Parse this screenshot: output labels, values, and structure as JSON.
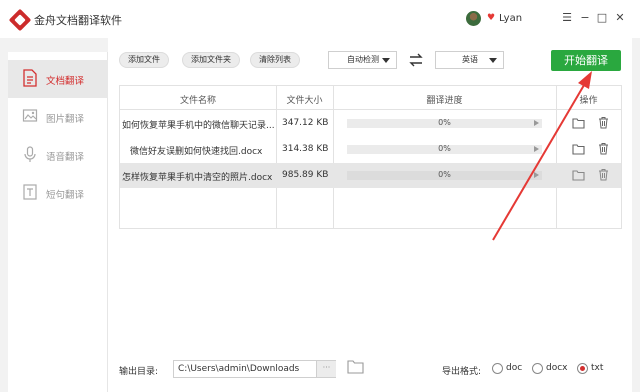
{
  "app": {
    "title": "金舟文档翻译软件",
    "user_name": "Lyan"
  },
  "window_controls": {
    "settings": "☰",
    "minimize": "−",
    "maximize": "□",
    "close": "✕"
  },
  "sidebar": {
    "items": [
      {
        "label": "文档翻译",
        "icon": "document-icon",
        "active": true
      },
      {
        "label": "图片翻译",
        "icon": "image-icon",
        "active": false
      },
      {
        "label": "语音翻译",
        "icon": "microphone-icon",
        "active": false
      },
      {
        "label": "短句翻译",
        "icon": "text-icon",
        "active": false
      }
    ]
  },
  "toolbar": {
    "add_file": "添加文件",
    "add_folder": "添加文件夹",
    "clear_list": "清除列表",
    "source_lang": "自动检测",
    "target_lang": "英语",
    "start": "开始翻译"
  },
  "table": {
    "headers": {
      "name": "文件名称",
      "size": "文件大小",
      "progress": "翻译进度",
      "actions": "操作"
    },
    "rows": [
      {
        "name": "如何恢复苹果手机中的微信聊天记录...",
        "size": "347.12 KB",
        "progress": "0%"
      },
      {
        "name": "微信好友误删如何快速找回.docx",
        "size": "314.38 KB",
        "progress": "0%"
      },
      {
        "name": "怎样恢复苹果手机中清空的照片.docx",
        "size": "985.89 KB",
        "progress": "0%"
      }
    ]
  },
  "bottom": {
    "output_label": "输出目录:",
    "output_path": "C:\\Users\\admin\\Downloads",
    "browse": "···",
    "format_label": "导出格式:",
    "formats": [
      "doc",
      "docx",
      "txt"
    ],
    "selected_format": "txt"
  },
  "colors": {
    "accent_red": "#d32f2f",
    "start_green": "#2aa83f",
    "annotation_arrow": "#e53935"
  }
}
